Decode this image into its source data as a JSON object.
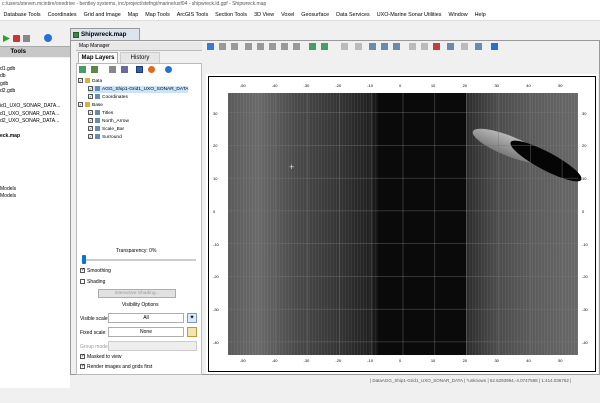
{
  "window": {
    "title": "c:/users/steven.mcintire/onedrive - bentley systems, inc/project/stefngi/marine/uxf04 - shipwreck.ld.gpf - Shipwreck.map"
  },
  "menu": [
    "Database Tools",
    "Coordinates",
    "Grid and Image",
    "Map",
    "Map Tools",
    "ArcGIS Tools",
    "Section Tools",
    "3D View",
    "Voxel",
    "Geosurface",
    "Data Services",
    "UXO-Marine Sonar Utilities",
    "Window",
    "Help"
  ],
  "left_panel": {
    "tab": "Tools",
    "items": [
      "",
      "d1.gdb",
      "db",
      "gdb",
      "d2.gdb",
      "",
      "id1_UXO_SONAR_DATA...",
      "d1_UXO_SONAR_DATA...",
      "d2_UXO_SONAR_DATA...",
      "",
      "eck.map",
      "",
      "",
      "",
      "",
      "",
      "",
      "Models",
      "Models"
    ]
  },
  "document": {
    "tab": "Shipwreck.map"
  },
  "map_manager": {
    "title": "Map Manager",
    "tabs": [
      "Map Layers",
      "History"
    ],
    "tree": [
      {
        "label": "Data",
        "level": 0
      },
      {
        "label": "AGG_Ship1-Grid1_UXO_SONAR_DATA",
        "level": 1,
        "selected": true
      },
      {
        "label": "Coordinates",
        "level": 1
      },
      {
        "label": "Base",
        "level": 0
      },
      {
        "label": "Titles",
        "level": 1
      },
      {
        "label": "North_Arrow",
        "level": 1
      },
      {
        "label": "Scale_Bar",
        "level": 1
      },
      {
        "label": "Surround",
        "level": 1
      }
    ],
    "transparency_label": "Transparency: 0%",
    "transparency": 0,
    "smoothing_label": "Smoothing",
    "shading_label": "Shading",
    "interactive_shading_label": "Interactive Shading...",
    "visibility_options_label": "Visibility Options",
    "visible_scale_label": "Visible scale:",
    "visible_scale_value": "All",
    "fixed_scale_label": "Fixed scale:",
    "fixed_scale_value": "None",
    "group_mode_label": "Group mode:",
    "masked_label": "Masked to view",
    "render_label": "Render images and grids first"
  },
  "map": {
    "top_ticks": [
      "-50",
      "-40",
      "-30",
      "-20",
      "-10",
      "0",
      "10",
      "20",
      "30",
      "40",
      "50"
    ],
    "bottom_ticks": [
      "-50",
      "-40",
      "-30",
      "-20",
      "-10",
      "0",
      "10",
      "20",
      "30",
      "40",
      "50"
    ],
    "left_ticks": [
      "30",
      "20",
      "10",
      "0",
      "-10",
      "-20",
      "-30",
      "-40"
    ],
    "right_ticks": [
      "30",
      "20",
      "10",
      "0",
      "-10",
      "-20",
      "-30",
      "-40"
    ]
  },
  "status": {
    "text": "| DataAGG_Ship1-Grid1_UXO_SONAR_DATA | *unknown | 52.6293994,-4.0747588 | 1:414.036762 |"
  },
  "colors": {
    "selection": "#cce4f7",
    "sonar_dark": "#0a0a0a",
    "tab_active": "#dde4ee"
  }
}
